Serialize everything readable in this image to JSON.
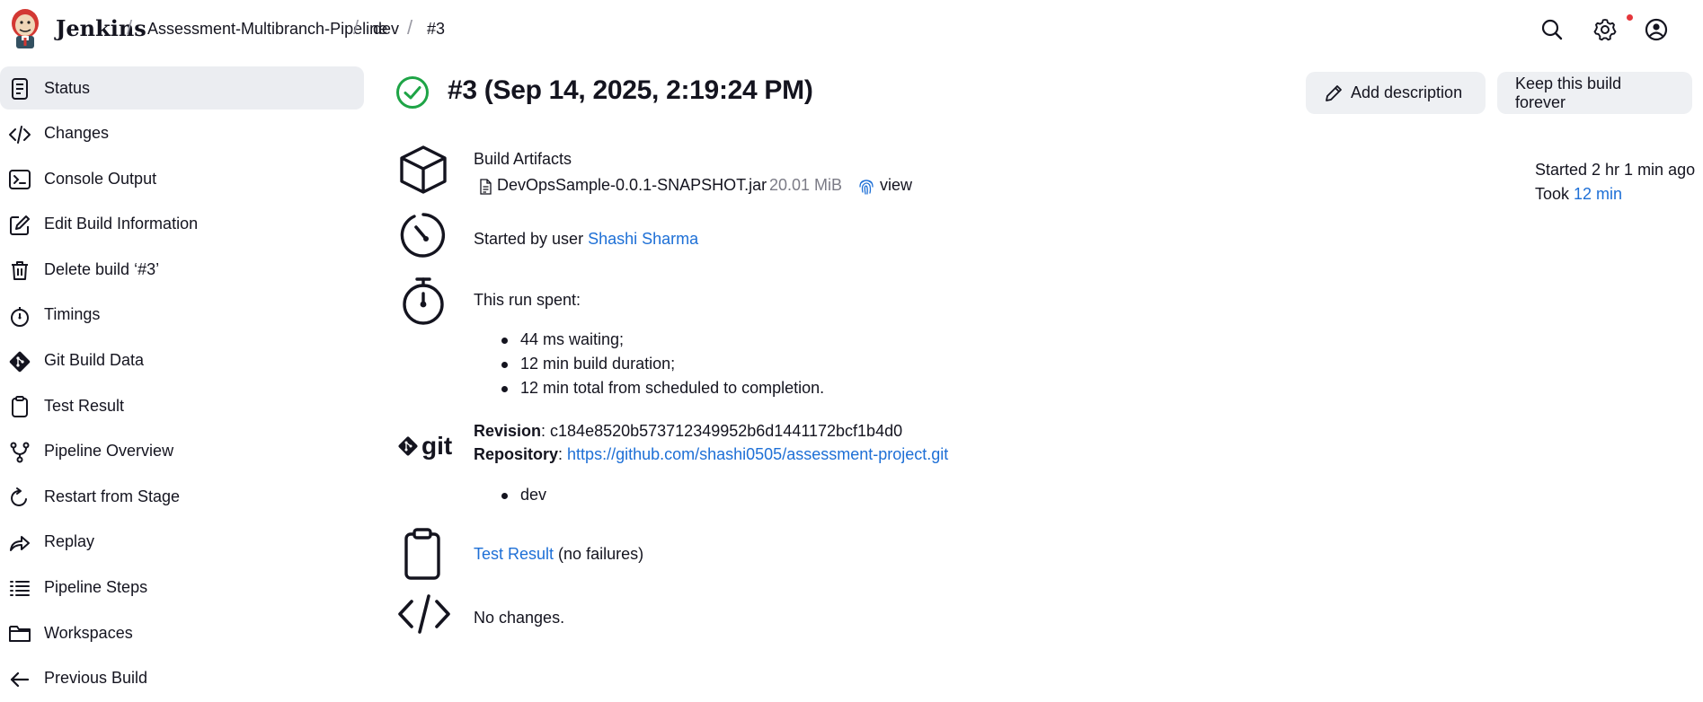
{
  "header": {
    "brand": "Jenkins",
    "breadcrumbs": [
      "Assessment-Multibranch-Pipeline",
      "dev",
      "#3"
    ],
    "separator": "/",
    "icons": [
      "search-icon",
      "settings-icon",
      "user-icon"
    ]
  },
  "sidebar": {
    "items": [
      {
        "label": "Status",
        "icon": "status-icon",
        "active": true
      },
      {
        "label": "Changes",
        "icon": "code-icon"
      },
      {
        "label": "Console Output",
        "icon": "terminal-icon"
      },
      {
        "label": "Edit Build Information",
        "icon": "edit-icon"
      },
      {
        "label": "Delete build ‘#3’",
        "icon": "trash-icon"
      },
      {
        "label": "Timings",
        "icon": "stopwatch-icon"
      },
      {
        "label": "Git Build Data",
        "icon": "git-icon"
      },
      {
        "label": "Test Result",
        "icon": "clipboard-icon"
      },
      {
        "label": "Pipeline Overview",
        "icon": "pipeline-icon"
      },
      {
        "label": "Restart from Stage",
        "icon": "restart-icon"
      },
      {
        "label": "Replay",
        "icon": "replay-icon"
      },
      {
        "label": "Pipeline Steps",
        "icon": "list-icon"
      },
      {
        "label": "Workspaces",
        "icon": "folder-icon"
      },
      {
        "label": "Previous Build",
        "icon": "arrow-left-icon"
      }
    ]
  },
  "main": {
    "title": "#3 (Sep 14, 2025, 2:19:24 PM)",
    "add_description": "Add description",
    "keep_forever": "Keep this build forever",
    "artifacts": {
      "heading": "Build Artifacts",
      "file": "DevOpsSample-0.0.1-SNAPSHOT.jar",
      "size": "20.01 MiB",
      "view": "view"
    },
    "started_by": {
      "prefix": "Started by user ",
      "user": "Shashi Sharma"
    },
    "run_spent": {
      "heading": "This run spent:",
      "items": [
        "44 ms waiting;",
        "12 min build duration;",
        "12 min total from scheduled to completion."
      ]
    },
    "git": {
      "logo_text": "git",
      "revision_label": "Revision",
      "revision": ": c184e8520b573712349952b6d1441172bcf1b4d0",
      "repository_label": "Repository",
      "repository_sep": ": ",
      "repository_url": "https://github.com/shashi0505/assessment-project.git",
      "branches": [
        "dev"
      ]
    },
    "test_result": {
      "link": "Test Result",
      "suffix": " (no failures)"
    },
    "changes": "No changes.",
    "info": {
      "started": "Started 2 hr 1 min ago",
      "took_prefix": "Took ",
      "took_value": "12 min"
    }
  }
}
